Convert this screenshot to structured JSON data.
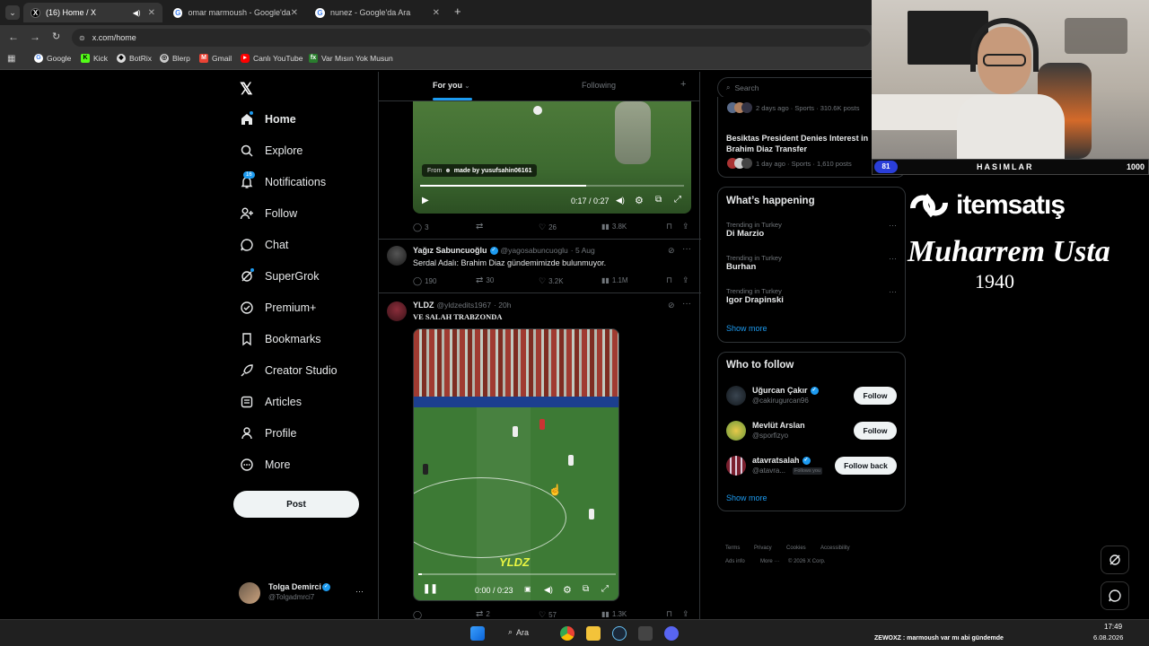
{
  "browser": {
    "tabs": [
      {
        "title": "(16) Home / X",
        "active": true
      },
      {
        "title": "omar marmoush - Google'da Ar",
        "active": false
      },
      {
        "title": "nunez - Google'da Ara",
        "active": false
      }
    ],
    "url": "x.com/home",
    "bookmarks": [
      "Google",
      "Kick",
      "BotRix",
      "Blerp",
      "Gmail",
      "Canlı YouTube",
      "Var Mısın Yok Musun"
    ]
  },
  "nav": {
    "items": [
      {
        "label": "Home",
        "icon": "home-icon"
      },
      {
        "label": "Explore",
        "icon": "search-icon"
      },
      {
        "label": "Notifications",
        "icon": "bell-icon",
        "badge": "16"
      },
      {
        "label": "Follow",
        "icon": "person-add-icon"
      },
      {
        "label": "Chat",
        "icon": "chat-icon"
      },
      {
        "label": "SuperGrok",
        "icon": "grok-icon"
      },
      {
        "label": "Premium+",
        "icon": "verified-icon"
      },
      {
        "label": "Bookmarks",
        "icon": "bookmark-icon"
      },
      {
        "label": "Creator Studio",
        "icon": "rocket-icon"
      },
      {
        "label": "Articles",
        "icon": "article-icon"
      },
      {
        "label": "Profile",
        "icon": "person-icon"
      },
      {
        "label": "More",
        "icon": "more-circle-icon"
      }
    ],
    "post_label": "Post",
    "account": {
      "name": "Tolga Demirci",
      "handle": "@Tolgadmrci7",
      "more": "···"
    }
  },
  "timeline": {
    "tabs": {
      "for_you": "For you",
      "following": "Following",
      "plus": "+"
    },
    "video1": {
      "from": "From",
      "made_by": "made by yusufsahin06161",
      "time": "0:17 / 0:27",
      "stats": {
        "replies": "3",
        "likes": "26",
        "views": "3.8K"
      }
    },
    "post1": {
      "name": "Yağız Sabuncuoğlu",
      "handle": "@yagosabuncuoglu",
      "date": "· 5 Aug",
      "text": "Serdal Adalı: Brahim Diaz gündemimizde bulunmuyor.",
      "stats": {
        "replies": "190",
        "reposts": "30",
        "likes": "3.2K",
        "views": "1.1M"
      }
    },
    "post2": {
      "name": "YLDZ",
      "handle": "@yldzedits1967",
      "date": "· 20h",
      "text": "VE SALAH TRABZONDA",
      "watermark": "YLDZ",
      "time": "0:00 / 0:23",
      "stats": {
        "reposts": "2",
        "likes": "57",
        "views": "1.3K"
      }
    }
  },
  "right": {
    "search_placeholder": "Search",
    "top_meta": "2 days ago · Sports · 310.6K posts",
    "news_title": "Besiktas President Denies Interest in Brahim Diaz Transfer",
    "news_meta": "1 day ago · Sports · 1,610 posts",
    "whats_happening": "What’s happening",
    "trends": [
      {
        "meta": "Trending in Turkey",
        "name": "Di Marzio"
      },
      {
        "meta": "Trending in Turkey",
        "name": "Burhan"
      },
      {
        "meta": "Trending in Turkey",
        "name": "Igor Drapinski"
      }
    ],
    "show_more": "Show more",
    "who_to_follow": "Who to follow",
    "suggestions": [
      {
        "name": "Uğurcan Çakır",
        "handle": "@cakirugurcan96",
        "button": "Follow",
        "verified": true
      },
      {
        "name": "Mevlüt Arslan",
        "handle": "@sporfizyo",
        "button": "Follow",
        "verified": false
      },
      {
        "name": "atavratsalah",
        "handle": "@atavra...",
        "button": "Follow back",
        "verified": true,
        "follows_you": "Follows you"
      }
    ],
    "show_more2": "Show more",
    "footer": [
      "Terms",
      "Privacy",
      "Cookies",
      "Accessibility",
      "Ads info",
      "More ···",
      "© 2026 X Corp."
    ]
  },
  "overlay": {
    "hasimlar": "HASIMLAR",
    "score_left": "81",
    "score_right": "1000",
    "brand": "itemsatış",
    "signature": "Muharrem Usta",
    "year": "1940"
  },
  "taskbar": {
    "search": "Ara",
    "ticker": "ZEWOXZ : marmoush var mı abi gündemde",
    "time": "17:49",
    "date": "6.08.2026"
  },
  "colors": {
    "accent": "#1d9bf0",
    "bg": "#000000",
    "border": "#2f3336",
    "muted": "#71767b"
  }
}
